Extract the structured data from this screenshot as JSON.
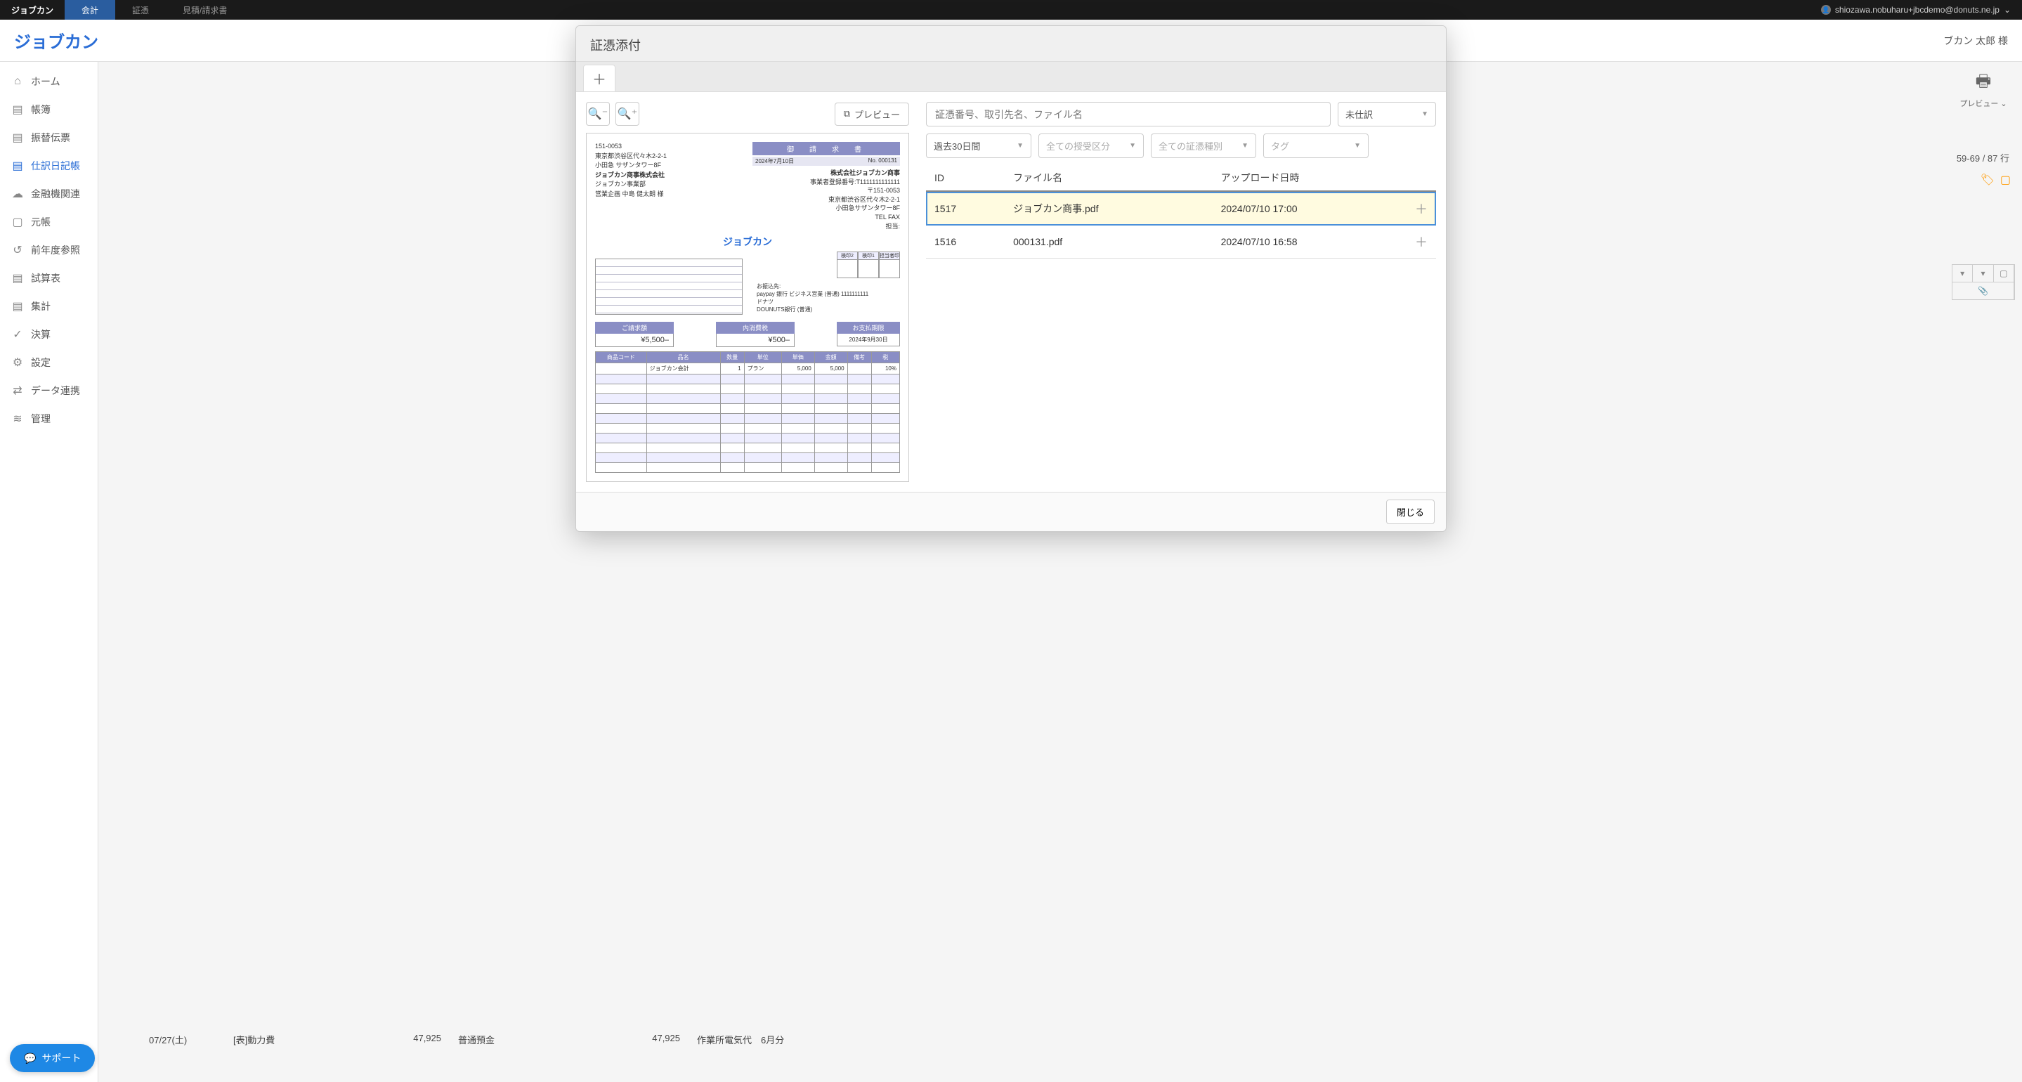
{
  "topbar": {
    "brand": "ジョブカン",
    "tabs": [
      "会計",
      "証憑",
      "見積/請求書"
    ],
    "active_tab": 0,
    "user_email": "shiozawa.nobuharu+jbcdemo@donuts.ne.jp"
  },
  "header": {
    "logo": "ジョブカン",
    "user_label": "ブカン 太郎 様"
  },
  "sidebar": {
    "items": [
      {
        "icon": "⌂",
        "label": "ホーム"
      },
      {
        "icon": "▤",
        "label": "帳簿"
      },
      {
        "icon": "▤",
        "label": "振替伝票"
      },
      {
        "icon": "▤",
        "label": "仕訳日記帳",
        "active": true
      },
      {
        "icon": "☁",
        "label": "金融機関連"
      },
      {
        "icon": "▢",
        "label": "元帳"
      },
      {
        "icon": "↺",
        "label": "前年度参照"
      },
      {
        "icon": "▤",
        "label": "試算表"
      },
      {
        "icon": "▤",
        "label": "集計"
      },
      {
        "icon": "✓",
        "label": "決算"
      },
      {
        "icon": "⚙",
        "label": "設定"
      },
      {
        "icon": "⇄",
        "label": "データ連携"
      },
      {
        "icon": "≋",
        "label": "管理"
      }
    ]
  },
  "right_panel": {
    "preview_label": "プレビュー",
    "row_range": "59-69 / 87 行"
  },
  "backdrop": {
    "date": "07/27(土)",
    "account": "[表]動力費",
    "amount1": "47,925",
    "transfer": "普通預金",
    "amount2": "47,925",
    "memo": "作業所電気代　6月分"
  },
  "modal": {
    "title": "証憑添付",
    "zoom_out": "−",
    "zoom_in": "+",
    "preview_button": "プレビュー",
    "search_placeholder": "証憑番号、取引先名、ファイル名",
    "filter_status": "未仕訳",
    "filter_period": "過去30日間",
    "filter_category": "全ての授受区分",
    "filter_type": "全ての証憑種別",
    "filter_tag": "タグ",
    "table_headers": {
      "id": "ID",
      "filename": "ファイル名",
      "uploaded": "アップロード日時"
    },
    "rows": [
      {
        "id": "1517",
        "filename": "ジョブカン商事.pdf",
        "uploaded": "2024/07/10 17:00",
        "selected": true
      },
      {
        "id": "1516",
        "filename": "000131.pdf",
        "uploaded": "2024/07/10 16:58",
        "selected": false
      }
    ],
    "close_label": "閉じる"
  },
  "invoice": {
    "sender_postal": "151-0053",
    "sender_addr1": "東京都渋谷区代々木2-2-1",
    "sender_addr2": "小田急 サザンタワー8F",
    "sender_company": "ジョブカン商事株式会社",
    "sender_dept": "ジョブカン事業部",
    "sender_person": "営業企画 中島 健太朗 様",
    "title": "御　請　求　書",
    "date": "2024年7月10日",
    "number": "No. 000131",
    "recipient_company": "株式会社ジョブカン商事",
    "recipient_reg": "事業者登録番号:T1111111111111",
    "recipient_postal": "〒151-0053",
    "recipient_addr1": "東京都渋谷区代々木2-2-1",
    "recipient_addr2": "小田急サザンタワー8F",
    "recipient_tel": "TEL FAX",
    "recipient_contact": "担当:",
    "brand": "ジョブカン",
    "stamp_labels": [
      "検印2",
      "検印1",
      "担当者印"
    ],
    "bank_label": "お振込先:",
    "bank1": "paypay 銀行 ビジネス営業 (普通) 1111111111",
    "bank1b": "ドナツ",
    "bank2": "DOUNUTS銀行 (普通)",
    "total_label": "ご請求額",
    "total_value": "¥5,500–",
    "tax_label": "内消費税",
    "tax_value": "¥500–",
    "due_label": "お支払期限",
    "due_value": "2024年9月30日",
    "cols": [
      "商品コード",
      "品名",
      "数量",
      "単位",
      "単価",
      "金額",
      "備考",
      "税"
    ],
    "line": {
      "name": "ジョブカン会計",
      "qty": "1",
      "unit": "プラン",
      "price": "5,000",
      "amount": "5,000",
      "tax": "10%"
    }
  },
  "support": {
    "label": "サポート"
  }
}
